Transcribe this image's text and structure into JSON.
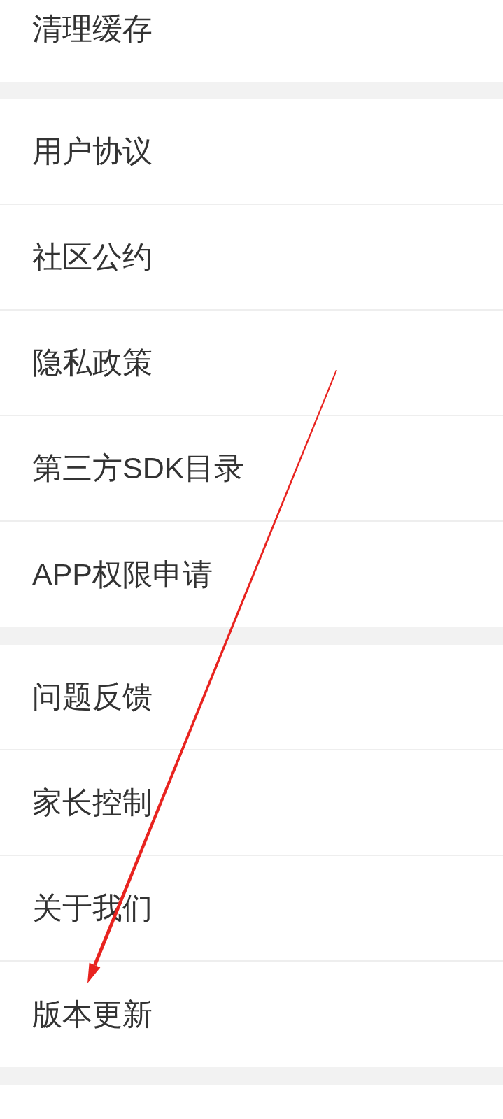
{
  "sections": [
    {
      "items": [
        {
          "label": "清理缓存"
        }
      ]
    },
    {
      "items": [
        {
          "label": "用户协议"
        },
        {
          "label": "社区公约"
        },
        {
          "label": "隐私政策"
        },
        {
          "label": "第三方SDK目录"
        },
        {
          "label": "APP权限申请"
        }
      ]
    },
    {
      "items": [
        {
          "label": "问题反馈"
        },
        {
          "label": "家长控制"
        },
        {
          "label": "关于我们"
        },
        {
          "label": "版本更新"
        }
      ]
    }
  ]
}
